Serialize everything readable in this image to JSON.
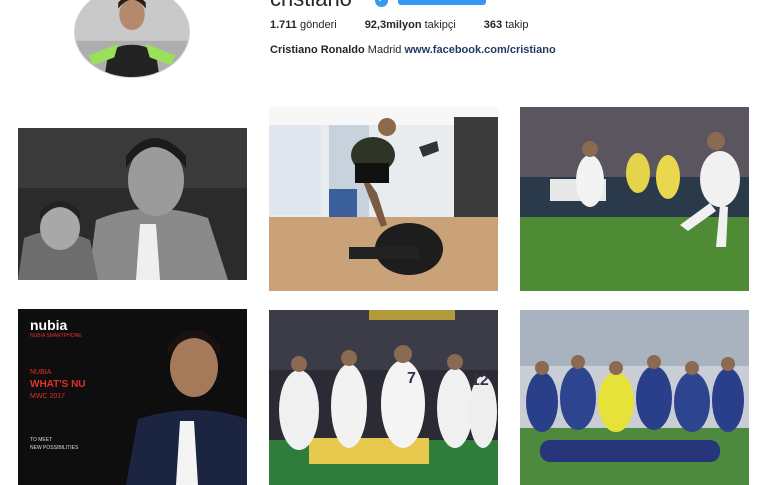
{
  "profile": {
    "username": "cristiano",
    "verified_icon": "verified-badge-icon",
    "stats": {
      "posts_value": "1.711",
      "posts_label": "gönderi",
      "followers_value": "92,3milyon",
      "followers_label": "takipçi",
      "following_value": "363",
      "following_label": "takip"
    },
    "bio": {
      "name": "Cristiano Ronaldo",
      "text": "Madrid",
      "link": "www.facebook.com/cristiano"
    }
  },
  "posts": [
    {
      "name": "post-1",
      "subject": "black-and-white portrait with son"
    },
    {
      "name": "post-2",
      "subject": "stationary bike in gym"
    },
    {
      "name": "post-3",
      "subject": "penalty kick match photo"
    },
    {
      "name": "post-4",
      "subject": "Nubia ad",
      "brand": "nubia",
      "brand_sub": "NUBIA SMARTPHONE",
      "tag": "NUBIA",
      "headline": "WHAT'S NU",
      "event": "MWC 2017",
      "footer_1": "TO MEET",
      "footer_2": "NEW POSSIBILITIES"
    },
    {
      "name": "post-5",
      "subject": "team celebration",
      "jersey_1": "7",
      "jersey_2": "12"
    },
    {
      "name": "post-6",
      "subject": "team training group photo"
    }
  ],
  "colors": {
    "accent": "#3897f0",
    "link": "#1d3a5f",
    "nubia_red": "#e1302b"
  }
}
